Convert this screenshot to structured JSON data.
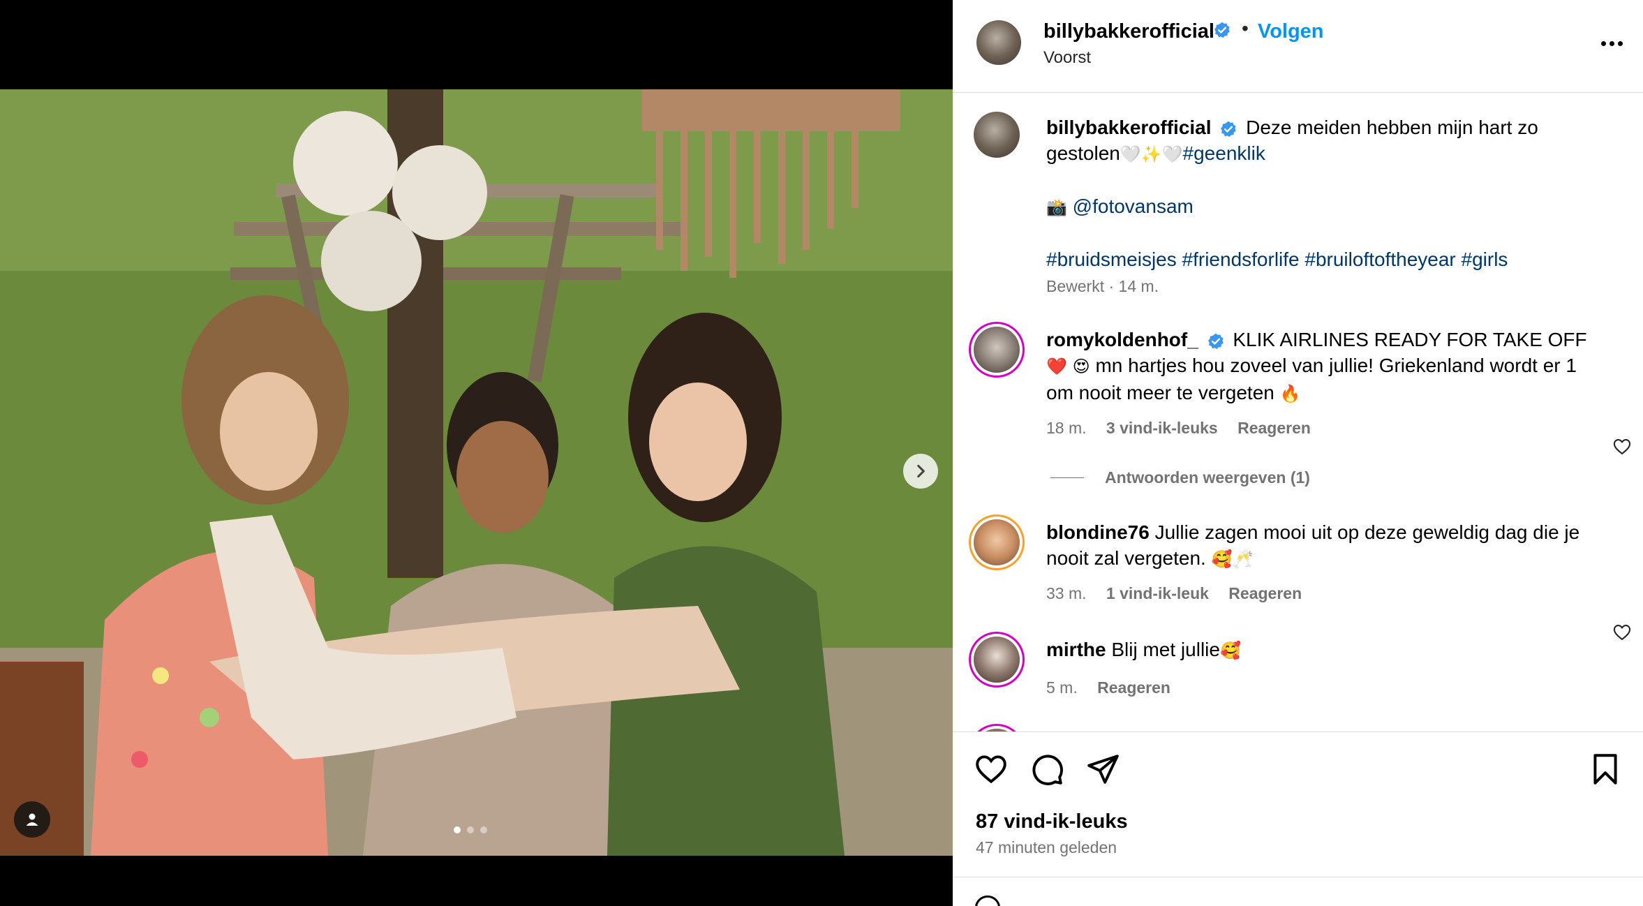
{
  "post": {
    "username": "billybakkerofficial",
    "verified": true,
    "follow_label": "Volgen",
    "separator": "•",
    "location": "Voorst",
    "more_icon": "more-horizontal-icon",
    "carousel_dots": 3,
    "carousel_active": 1
  },
  "caption": {
    "username": "billybakkerofficial",
    "text_part1": "Deze meiden hebben mijn hart zo gestolen",
    "emoji_part1": "🤍✨🤍",
    "hashtag_geenklik": "#geenklik",
    "camera_emoji": "📸",
    "mention": "@fotovansam",
    "hashtags": "#bruidsmeisjes #friendsforlife #bruiloftoftheyear #girls",
    "edited": "Bewerkt",
    "dot": "·",
    "age": "14 m."
  },
  "comments": [
    {
      "username": "romykoldenhof_",
      "verified": true,
      "text_part1": "KLIK AIRLINES READY FOR TAKE OFF",
      "emoji1": "❤️",
      "emoji2": "😍",
      "text_part2": "mn hartjes hou zoveel van jullie! Griekenland wordt er 1 om nooit meer te vergeten",
      "emoji3": "🔥",
      "age": "18 m.",
      "likes": "3 vind-ik-leuks",
      "reply": "Reageren",
      "view_replies": "Antwoorden weergeven (1)"
    },
    {
      "username": "blondine76",
      "verified": false,
      "text": "Jullie zagen mooi uit op deze geweldig dag die je nooit zal vergeten.",
      "emoji": "🥰🥂",
      "age": "33 m.",
      "likes": "1 vind-ik-leuk",
      "reply": "Reageren"
    },
    {
      "username": "mirthe",
      "verified": false,
      "text": "Blij met jullie",
      "emoji": "🥰",
      "age": "5 m.",
      "reply": "Reageren"
    }
  ],
  "actions": {
    "like_icon": "heart-icon",
    "comment_icon": "comment-icon",
    "share_icon": "paper-plane-icon",
    "save_icon": "bookmark-icon"
  },
  "stats": {
    "likes": "87 vind-ik-leuks",
    "posted": "47 minuten geleden"
  },
  "colors": {
    "link": "#00376b",
    "follow": "#0095f6",
    "muted": "#737373",
    "verified": "#3897f0",
    "border": "#dbdbdb"
  }
}
